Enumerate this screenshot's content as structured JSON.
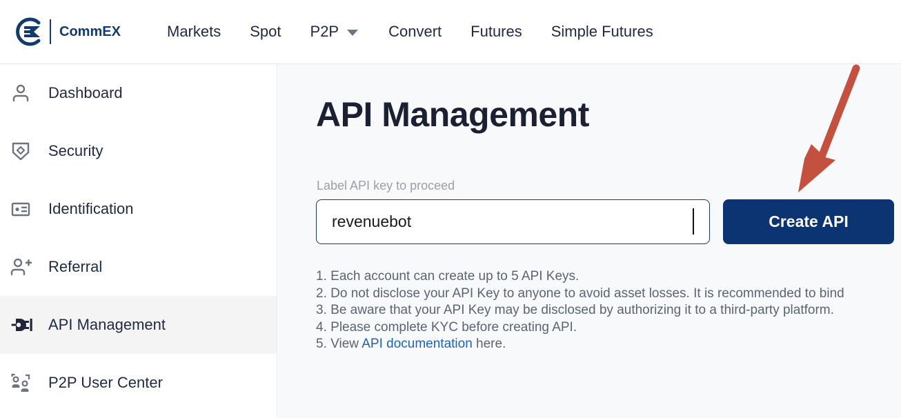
{
  "brand": {
    "name": "CommEX",
    "logo_icon": "commex-circle-ex-logo",
    "color": "#123a6e"
  },
  "header": {
    "nav_items": [
      {
        "label": "Markets",
        "has_dropdown": false
      },
      {
        "label": "Spot",
        "has_dropdown": false
      },
      {
        "label": "P2P",
        "has_dropdown": true
      },
      {
        "label": "Convert",
        "has_dropdown": false
      },
      {
        "label": "Futures",
        "has_dropdown": false
      },
      {
        "label": "Simple Futures",
        "has_dropdown": false
      }
    ]
  },
  "sidebar": {
    "items": [
      {
        "label": "Dashboard",
        "icon": "user-icon",
        "active": false
      },
      {
        "label": "Security",
        "icon": "shield-icon",
        "active": false
      },
      {
        "label": "Identification",
        "icon": "id-card-icon",
        "active": false
      },
      {
        "label": "Referral",
        "icon": "user-plus-icon",
        "active": false
      },
      {
        "label": "API Management",
        "icon": "plug-icon",
        "active": true
      },
      {
        "label": "P2P User Center",
        "icon": "p2p-users-icon",
        "active": false
      }
    ],
    "active_background": "#f4f4f4"
  },
  "main": {
    "title": "API Management",
    "field_label": "Label API key to proceed",
    "api_label_input": {
      "value": "revenuebot",
      "placeholder": ""
    },
    "create_button": {
      "label": "Create API",
      "background": "#0c3472",
      "text_color": "#ffffff"
    },
    "notes": [
      {
        "number": "1.",
        "text": "Each account can create up to 5 API Keys."
      },
      {
        "number": "2.",
        "text": "Do not disclose your API Key to anyone to avoid asset losses. It is recommended to bind"
      },
      {
        "number": "3.",
        "text": "Be aware that your API Key may be disclosed by authorizing it to a third-party platform."
      },
      {
        "number": "4.",
        "text": "Please complete KYC before creating API."
      },
      {
        "number": "5.",
        "prefix": "View ",
        "link_text": "API documentation",
        "suffix": " here."
      }
    ]
  },
  "annotation": {
    "arrow": {
      "name": "red-pointer-arrow",
      "color": "#c4513f",
      "points_to": "create-api-button"
    }
  }
}
